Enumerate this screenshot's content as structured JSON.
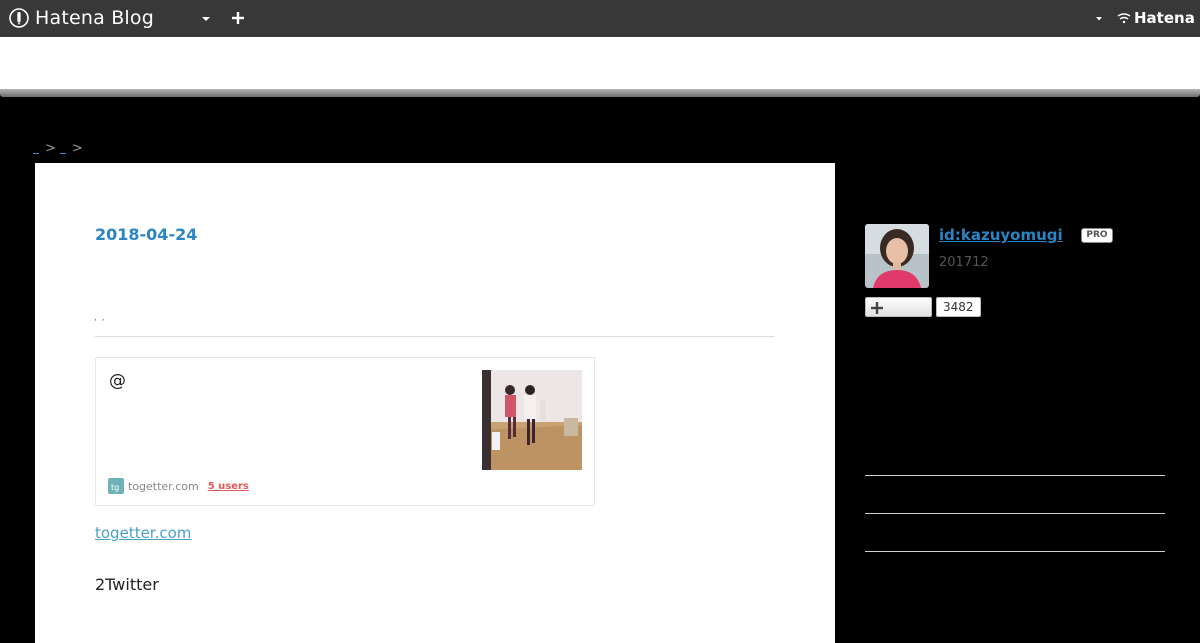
{
  "topbar": {
    "brand": "Hatena Blog",
    "brand_icon": "hatena-blog-icon",
    "right_logo": "Hatena",
    "background": "#383838"
  },
  "breadcrumb": {
    "separator": ">"
  },
  "entry": {
    "date": "2018-04-24",
    "title_marks": ", ,",
    "card": {
      "title": "@",
      "domain": "togetter.com",
      "users": "5 users"
    },
    "source_link": "togetter.com",
    "paragraph": "2Twitter"
  },
  "profile": {
    "id": "id:kazuyomugi",
    "badge": "PRO",
    "since": "201712",
    "follow_icon": "plus-icon",
    "follower_count": "3482"
  },
  "colors": {
    "link_blue": "#2a85c4",
    "users_red": "#e05a5a",
    "page_bg": "#000000",
    "content_bg": "#ffffff"
  }
}
